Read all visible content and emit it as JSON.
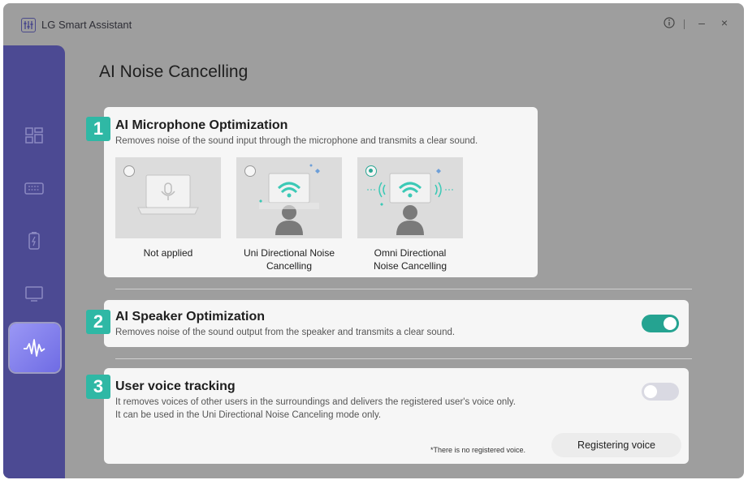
{
  "window": {
    "title": "LG Smart Assistant",
    "controls": {
      "info_icon": "info-icon",
      "minimize": "–",
      "close": "×"
    }
  },
  "sidebar": {
    "items": [
      {
        "icon": "dashboard-icon",
        "active": false
      },
      {
        "icon": "keyboard-icon",
        "active": false
      },
      {
        "icon": "battery-icon",
        "active": false
      },
      {
        "icon": "monitor-icon",
        "active": false
      },
      {
        "icon": "audio-wave-icon",
        "active": true
      }
    ]
  },
  "page": {
    "title": "AI Noise Cancelling"
  },
  "mic": {
    "number": "1",
    "title": "AI Microphone Optimization",
    "description": "Removes noise of the sound input through the microphone and transmits a clear sound.",
    "options": [
      {
        "label_line1": "Not applied",
        "label_line2": "",
        "selected": false
      },
      {
        "label_line1": "Uni Directional Noise",
        "label_line2": "Cancelling",
        "selected": false
      },
      {
        "label_line1": "Omni Directional",
        "label_line2": "Noise Cancelling",
        "selected": true
      }
    ]
  },
  "speaker": {
    "number": "2",
    "title": "AI Speaker Optimization",
    "description": "Removes noise of the sound output from the speaker and transmits a clear sound.",
    "enabled": true
  },
  "voice": {
    "number": "3",
    "title": "User voice tracking",
    "description_line1": "It removes voices of other users in the surroundings and delivers the registered user's voice only.",
    "description_line2": "It can be used in the Uni Directional Noise Canceling mode only.",
    "note": "*There is no registered voice.",
    "button_label": "Registering voice",
    "enabled": false
  },
  "colors": {
    "accent": "#25a391",
    "sidebar": "#4c4a93",
    "badge": "#2fb8a5"
  }
}
